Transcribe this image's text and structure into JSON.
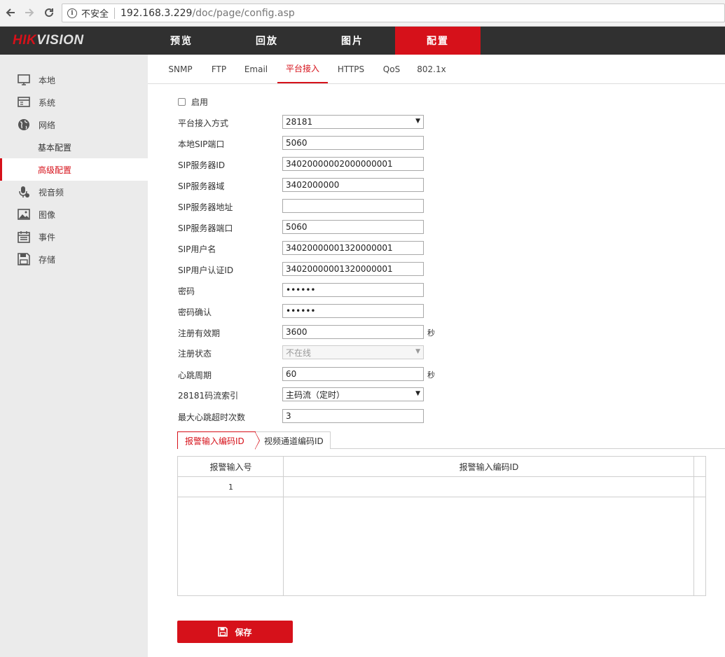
{
  "browser": {
    "security_label": "不安全",
    "url_host": "192.168.3.229",
    "url_path": "/doc/page/config.asp"
  },
  "header": {
    "logo_hik": "HIK",
    "logo_vision": "VISION",
    "nav": [
      "预览",
      "回放",
      "图片",
      "配置"
    ],
    "active_nav": "配置",
    "accent_color": "#d6111a"
  },
  "sidebar": {
    "items": [
      {
        "label": "本地",
        "icon": "monitor-icon"
      },
      {
        "label": "系统",
        "icon": "window-icon"
      },
      {
        "label": "网络",
        "icon": "globe-icon"
      },
      {
        "label": "视音频",
        "icon": "mic-icon"
      },
      {
        "label": "图像",
        "icon": "image-icon"
      },
      {
        "label": "事件",
        "icon": "calendar-icon"
      },
      {
        "label": "存储",
        "icon": "disk-icon"
      }
    ],
    "sub_items": [
      "基本配置",
      "高级配置"
    ],
    "active_sub": "高级配置"
  },
  "tabs": [
    "SNMP",
    "FTP",
    "Email",
    "平台接入",
    "HTTPS",
    "QoS",
    "802.1x"
  ],
  "active_tab": "平台接入",
  "form": {
    "enable_label": "启用",
    "enabled": false,
    "fields": {
      "access_mode": {
        "label": "平台接入方式",
        "value": "28181"
      },
      "local_sip_port": {
        "label": "本地SIP端口",
        "value": "5060"
      },
      "sip_server_id": {
        "label": "SIP服务器ID",
        "value": "34020000002000000001"
      },
      "sip_server_domain": {
        "label": "SIP服务器域",
        "value": "3402000000"
      },
      "sip_server_address": {
        "label": "SIP服务器地址",
        "value": ""
      },
      "sip_server_port": {
        "label": "SIP服务器端口",
        "value": "5060"
      },
      "sip_username": {
        "label": "SIP用户名",
        "value": "34020000001320000001"
      },
      "sip_auth_id": {
        "label": "SIP用户认证ID",
        "value": "34020000001320000001"
      },
      "password": {
        "label": "密码",
        "value": "••••••"
      },
      "password_confirm": {
        "label": "密码确认",
        "value": "••••••"
      },
      "register_expiry": {
        "label": "注册有效期",
        "value": "3600",
        "unit": "秒"
      },
      "register_status": {
        "label": "注册状态",
        "value": "不在线"
      },
      "heartbeat_period": {
        "label": "心跳周期",
        "value": "60",
        "unit": "秒"
      },
      "stream_index": {
        "label": "28181码流索引",
        "value": "主码流（定时）"
      },
      "max_heartbeat_timeout": {
        "label": "最大心跳超时次数",
        "value": "3"
      }
    }
  },
  "subtabs": [
    "报警输入编码ID",
    "视频通道编码ID"
  ],
  "active_subtab": "报警输入编码ID",
  "table": {
    "headers": [
      "报警输入号",
      "报警输入编码ID"
    ],
    "rows": [
      [
        "1",
        ""
      ]
    ]
  },
  "save_label": "保存"
}
